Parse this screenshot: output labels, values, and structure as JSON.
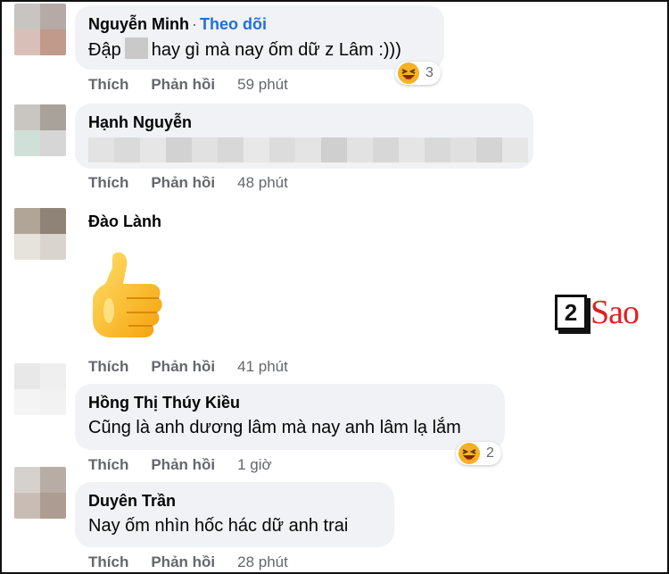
{
  "comments": [
    {
      "author": "Nguyễn Minh",
      "follow_label": "Theo dõi",
      "text_before": "Đập",
      "text_after": "hay gì mà nay ốm dữ z Lâm :)))",
      "time": "59 phút",
      "reaction_count": "3",
      "reaction_icon": "laughing-emoji-icon"
    },
    {
      "author": "Hạnh Nguyễn",
      "time": "48 phút"
    },
    {
      "author": "Đào Lành",
      "sticker_icon": "thumbs-up-sticker-icon",
      "time": "41 phút"
    },
    {
      "author": "Hồng Thị Thúy Kiều",
      "text": "Cũng là anh dương lâm mà nay anh lâm lạ lắm",
      "time": "1 giờ",
      "reaction_count": "2",
      "reaction_icon": "laughing-emoji-icon"
    },
    {
      "author": "Duyên Trần",
      "text": "Nay ốm nhìn hốc hác dữ anh trai",
      "time": "28 phút"
    }
  ],
  "actions": {
    "like": "Thích",
    "reply": "Phản hồi"
  },
  "watermark": {
    "number": "2",
    "word": "Sao"
  },
  "colors": {
    "bubble": "#f0f2f5",
    "follow_link": "#216fdb",
    "meta_text": "#65676b",
    "watermark_red": "#e02020"
  }
}
